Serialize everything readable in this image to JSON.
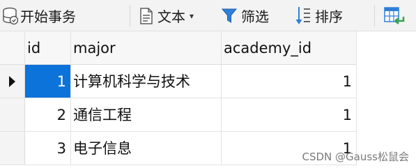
{
  "toolbar": {
    "begin_transaction": "开始事务",
    "text": "文本",
    "filter": "筛选",
    "sort": "排序"
  },
  "table": {
    "columns": [
      "id",
      "major",
      "academy_id"
    ],
    "rows": [
      {
        "id": "1",
        "major": "计算机科学与技术",
        "academy_id": "1"
      },
      {
        "id": "2",
        "major": "通信工程",
        "academy_id": "1"
      },
      {
        "id": "3",
        "major": "电子信息",
        "academy_id": "1"
      }
    ]
  },
  "watermark": "CSDN @Gauss松鼠会",
  "colors": {
    "selection": "#0b73d9",
    "toolbar_bg": "#f3f3f3",
    "filter_icon": "#2f7fd6"
  }
}
